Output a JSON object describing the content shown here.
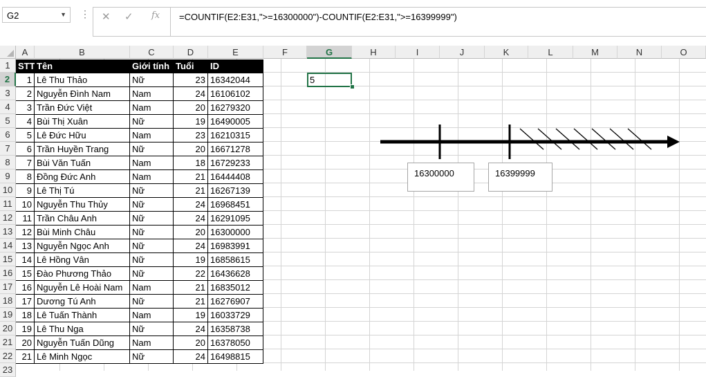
{
  "formula_bar": {
    "name_box": "G2",
    "formula": "=COUNTIF(E2:E31,\">=16300000\")-COUNTIF(E2:E31,\">=16399999\")",
    "cancel_icon": "close-icon",
    "enter_icon": "check-icon",
    "fx_label": "fx"
  },
  "columns": [
    "A",
    "B",
    "C",
    "D",
    "E",
    "F",
    "G",
    "H",
    "I",
    "J",
    "K",
    "L",
    "M",
    "N",
    "O"
  ],
  "selected_column": "G",
  "rows": [
    "1",
    "2",
    "3",
    "4",
    "5",
    "6",
    "7",
    "8",
    "9",
    "10",
    "11",
    "12",
    "13",
    "14",
    "15",
    "16",
    "17",
    "18",
    "19",
    "20",
    "21",
    "22",
    "23"
  ],
  "selected_row": "2",
  "table": {
    "headers": [
      "STT",
      "Tên",
      "Giới tính",
      "Tuổi",
      "ID"
    ],
    "rows": [
      [
        "1",
        "Lê Thu Thảo",
        "Nữ",
        "23",
        "16342044"
      ],
      [
        "2",
        "Nguyễn Đình Nam",
        "Nam",
        "24",
        "16106102"
      ],
      [
        "3",
        "Trần Đức Việt",
        "Nam",
        "20",
        "16279320"
      ],
      [
        "4",
        "Bùi Thị Xuân",
        "Nữ",
        "19",
        "16490005"
      ],
      [
        "5",
        "Lê Đức Hữu",
        "Nam",
        "23",
        "16210315"
      ],
      [
        "6",
        "Trần Huyền Trang",
        "Nữ",
        "20",
        "16671278"
      ],
      [
        "7",
        "Bùi Văn Tuấn",
        "Nam",
        "18",
        "16729233"
      ],
      [
        "8",
        "Đồng Đức Anh",
        "Nam",
        "21",
        "16444408"
      ],
      [
        "9",
        "Lê Thị Tú",
        "Nữ",
        "21",
        "16267139"
      ],
      [
        "10",
        "Nguyễn Thu Thủy",
        "Nữ",
        "24",
        "16968451"
      ],
      [
        "11",
        "Trần Châu Anh",
        "Nữ",
        "24",
        "16291095"
      ],
      [
        "12",
        "Bùi Minh Châu",
        "Nữ",
        "20",
        "16300000"
      ],
      [
        "13",
        "Nguyễn Ngọc Anh",
        "Nữ",
        "24",
        "16983991"
      ],
      [
        "14",
        "Lê Hồng Vân",
        "Nữ",
        "19",
        "16858615"
      ],
      [
        "15",
        "Đào Phương Thảo",
        "Nữ",
        "22",
        "16436628"
      ],
      [
        "16",
        "Nguyễn Lê Hoài Nam",
        "Nam",
        "21",
        "16835012"
      ],
      [
        "17",
        "Dương Tú Anh",
        "Nữ",
        "21",
        "16276907"
      ],
      [
        "18",
        "Lê Tuấn Thành",
        "Nam",
        "19",
        "16033729"
      ],
      [
        "19",
        "Lê Thu Nga",
        "Nữ",
        "24",
        "16358738"
      ],
      [
        "20",
        "Nguyễn Tuấn Dũng",
        "Nam",
        "20",
        "16378050"
      ],
      [
        "21",
        "Lê Minh Ngọc",
        "Nữ",
        "24",
        "16498815"
      ]
    ]
  },
  "result_cell": {
    "address": "G2",
    "value": "5"
  },
  "diagram": {
    "label_left": "16300000",
    "label_right": "16399999"
  },
  "colors": {
    "accent": "#217346",
    "header_fill": "#000000",
    "header_text": "#ffffff"
  }
}
